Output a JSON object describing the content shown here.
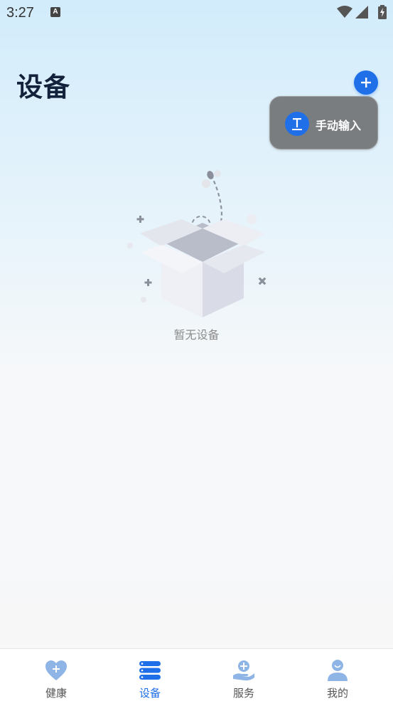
{
  "status_bar": {
    "time": "3:27",
    "notification_icon": "a-icon",
    "icons": [
      "wifi-icon",
      "signal-icon",
      "battery-icon"
    ]
  },
  "header": {
    "title": "设备",
    "add_icon": "plus-icon"
  },
  "popup_menu": {
    "items": [
      {
        "label": "手动输入",
        "icon": "text-input-icon"
      }
    ]
  },
  "empty_state": {
    "text": "暂无设备",
    "illustration": "open-box-icon"
  },
  "bottom_nav": {
    "items": [
      {
        "label": "健康",
        "icon": "heart-icon",
        "active": false
      },
      {
        "label": "设备",
        "icon": "device-list-icon",
        "active": true
      },
      {
        "label": "服务",
        "icon": "service-hand-icon",
        "active": false
      },
      {
        "label": "我的",
        "icon": "user-icon",
        "active": false
      }
    ]
  },
  "colors": {
    "accent": "#1f6fe8",
    "title": "#14213a",
    "popup_bg": "#7a7d80",
    "nav_inactive_icon": "#8fb4e6"
  }
}
